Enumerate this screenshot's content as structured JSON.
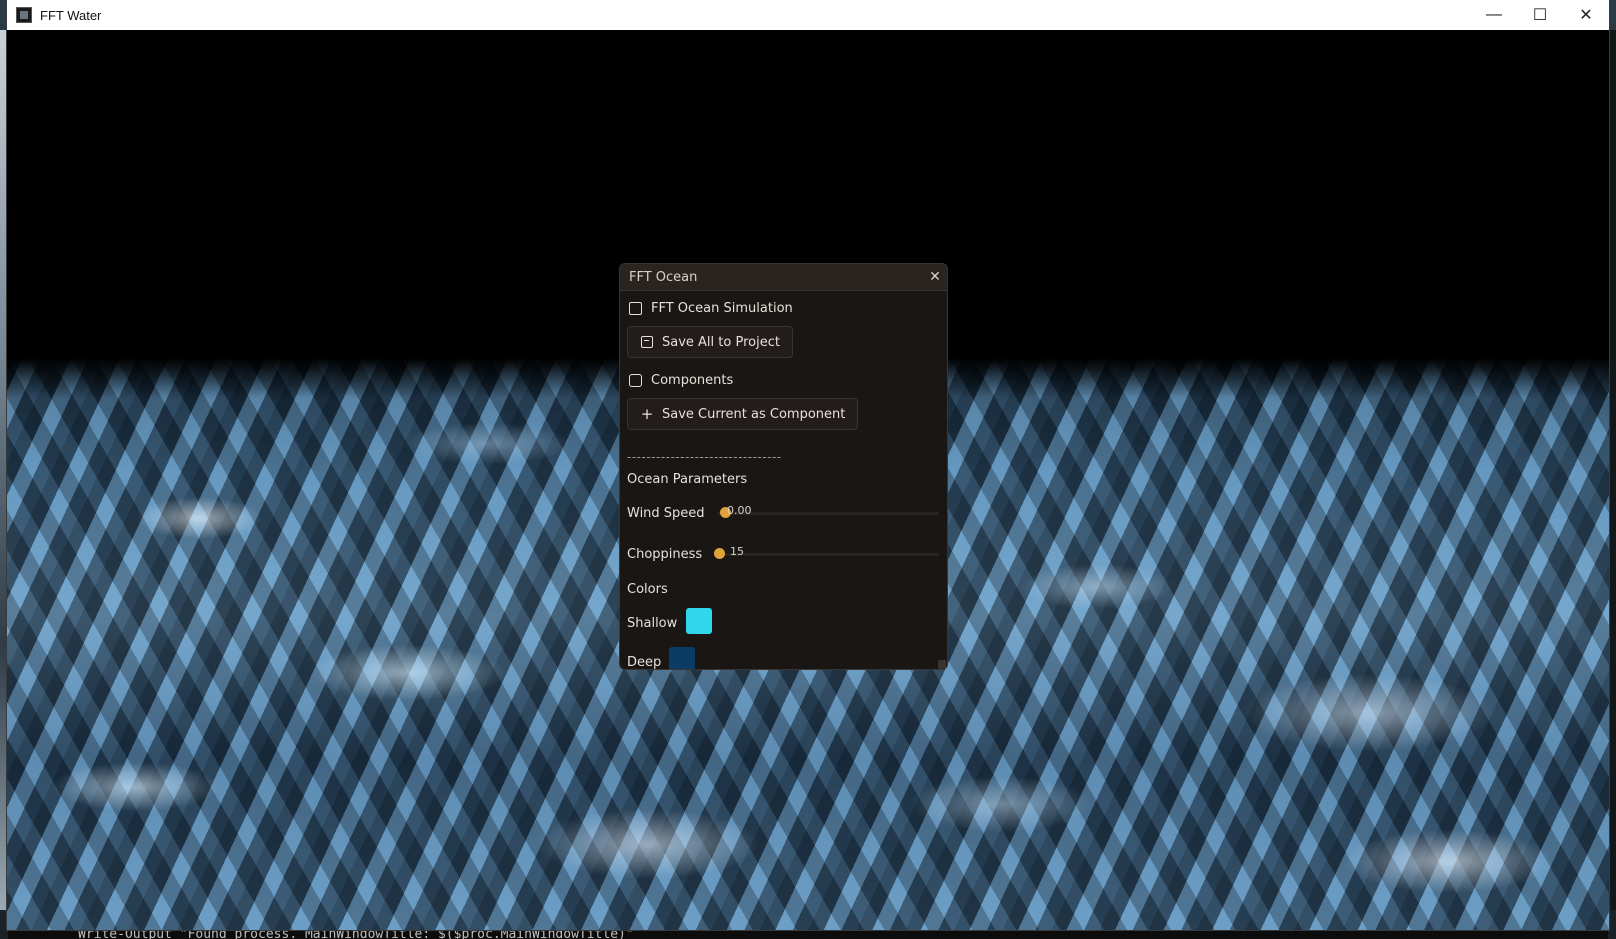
{
  "window": {
    "title": "FFT Water",
    "controls": {
      "minimize": "—",
      "maximize": "☐",
      "close": "✕"
    }
  },
  "terminal": {
    "text": "Write-Output \"Found process. MainWindowTitle: $($proc.MainWindowTitle)\""
  },
  "panel": {
    "title": "FFT Ocean",
    "close_glyph": "✕",
    "simulation_header": "FFT Ocean Simulation",
    "save_all_label": "Save All to Project",
    "components_header": "Components",
    "save_component_label": "Save Current as Component",
    "separator": "--------------------------------",
    "ocean_params_header": "Ocean Parameters",
    "wind_speed": {
      "label": "Wind Speed",
      "value_text": "0.00",
      "fraction": 0.0
    },
    "choppiness": {
      "label": "Choppiness",
      "value_text": "15",
      "fraction": 0.0
    },
    "colors_header": "Colors",
    "shallow": {
      "label": "Shallow",
      "color": "#2fd6ec"
    },
    "deep": {
      "label": "Deep",
      "color": "#0b3c66"
    }
  },
  "colors": {
    "accent": "#e0a33a",
    "panel_bg": "#1a1614"
  }
}
